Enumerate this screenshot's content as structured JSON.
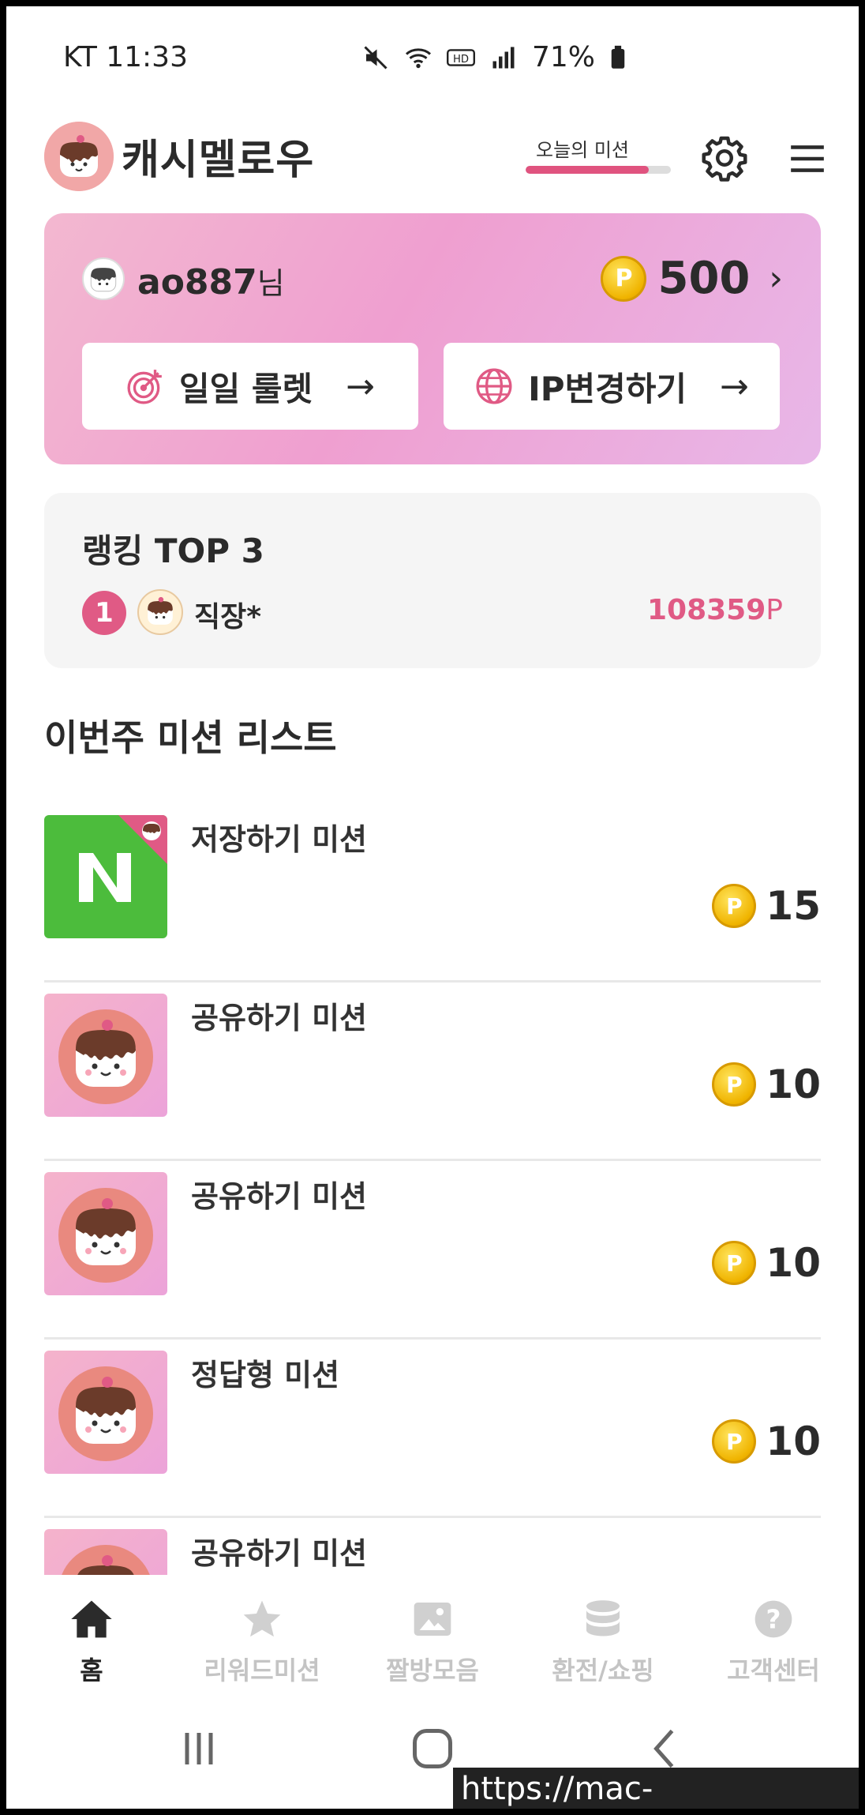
{
  "status_bar": {
    "carrier_time": "KT 11:33",
    "battery": "71%"
  },
  "header": {
    "app_title": "캐시멜로우",
    "mission_label": "오늘의 미션",
    "mission_progress": 0.85
  },
  "profile": {
    "username": "ao887",
    "username_suffix": "님",
    "points": "500",
    "buttons": [
      {
        "label": "일일 룰렛",
        "icon": "target-icon"
      },
      {
        "label": "IP변경하기",
        "icon": "globe-icon"
      }
    ]
  },
  "ranking": {
    "title": "랭킹 TOP 3",
    "entries": [
      {
        "rank": "1",
        "name": "직장*",
        "score": "108359",
        "unit": "P"
      }
    ]
  },
  "missions": {
    "section_title": "이번주 미션 리스트",
    "items": [
      {
        "name": "저장하기 미션",
        "reward": "15",
        "thumb": "naver"
      },
      {
        "name": "공유하기 미션",
        "reward": "10",
        "thumb": "mascot"
      },
      {
        "name": "공유하기 미션",
        "reward": "10",
        "thumb": "mascot"
      },
      {
        "name": "정답형 미션",
        "reward": "10",
        "thumb": "mascot"
      },
      {
        "name": "공유하기 미션",
        "reward": "",
        "thumb": "mascot"
      }
    ]
  },
  "bottom_nav": [
    {
      "label": "홈",
      "icon": "home-icon",
      "active": true
    },
    {
      "label": "리워드미션",
      "icon": "star-icon",
      "active": false
    },
    {
      "label": "짤방모음",
      "icon": "image-icon",
      "active": false
    },
    {
      "label": "환전/쇼핑",
      "icon": "database-icon",
      "active": false
    },
    {
      "label": "고객센터",
      "icon": "help-icon",
      "active": false
    }
  ],
  "watermark": "https://mac-os.tistory.com",
  "colors": {
    "accent": "#e05a85",
    "coin": "#f0b400",
    "card_gradient_start": "#f3b8d0",
    "card_gradient_end": "#e8b7e8"
  }
}
